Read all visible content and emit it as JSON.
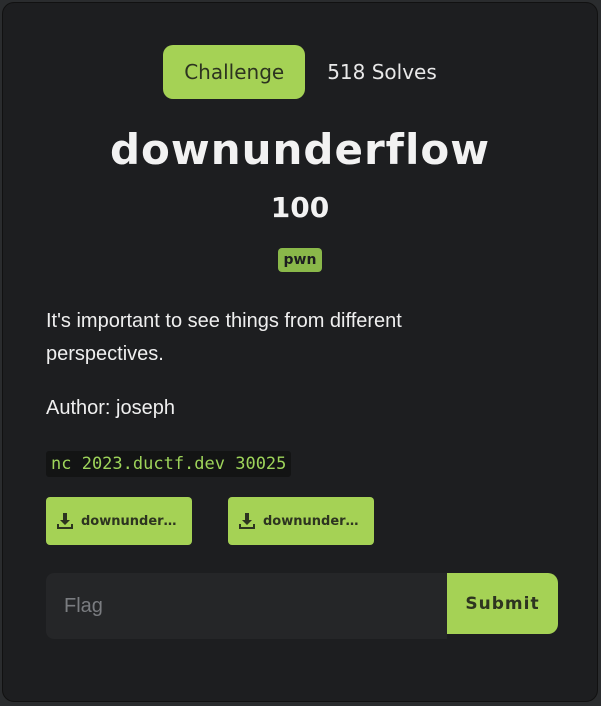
{
  "tabs": {
    "challenge_label": "Challenge",
    "solves_label": "518 Solves"
  },
  "challenge": {
    "title": "downunderflow",
    "points": "100",
    "category_tag": "pwn",
    "description": "It's important to see things from different perspectives.",
    "author": "Author: joseph",
    "connection": "nc 2023.ductf.dev 30025"
  },
  "files": [
    {
      "label": "downunderflow",
      "icon": "download-icon"
    },
    {
      "label": "downunderflow.c",
      "icon": "download-icon"
    }
  ],
  "flag_form": {
    "placeholder": "Flag",
    "value": "",
    "submit_label": "Submit"
  },
  "colors": {
    "accent": "#a5d255",
    "background": "#1d1e20",
    "code_text": "#9ed45a"
  }
}
